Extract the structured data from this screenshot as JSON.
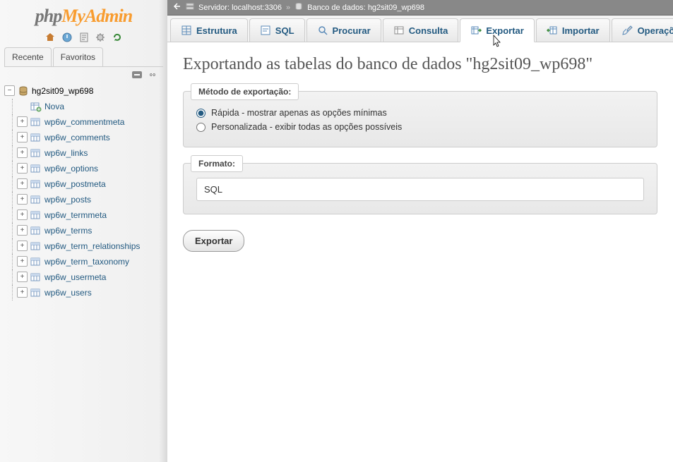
{
  "logo": {
    "php": "php",
    "my": "My",
    "admin": "Admin"
  },
  "sidebar_tabs": {
    "recent": "Recente",
    "favorites": "Favoritos"
  },
  "tree": {
    "root": "hg2sit09_wp698",
    "new_label": "Nova",
    "tables": [
      "wp6w_commentmeta",
      "wp6w_comments",
      "wp6w_links",
      "wp6w_options",
      "wp6w_postmeta",
      "wp6w_posts",
      "wp6w_termmeta",
      "wp6w_terms",
      "wp6w_term_relationships",
      "wp6w_term_taxonomy",
      "wp6w_usermeta",
      "wp6w_users"
    ]
  },
  "breadcrumb": {
    "server_label": "Servidor:",
    "server_value": "localhost:3306",
    "db_label": "Banco de dados:",
    "db_value": "hg2sit09_wp698"
  },
  "tabs": {
    "structure": "Estrutura",
    "sql": "SQL",
    "search": "Procurar",
    "query": "Consulta",
    "export": "Exportar",
    "import": "Importar",
    "operations": "Operações"
  },
  "page": {
    "title": "Exportando as tabelas do banco de dados \"hg2sit09_wp698\""
  },
  "export_method": {
    "legend": "Método de exportação:",
    "quick": "Rápida - mostrar apenas as opções mínimas",
    "custom": "Personalizada - exibir todas as opções possíveis"
  },
  "format": {
    "legend": "Formato:",
    "value": "SQL"
  },
  "buttons": {
    "export": "Exportar"
  }
}
